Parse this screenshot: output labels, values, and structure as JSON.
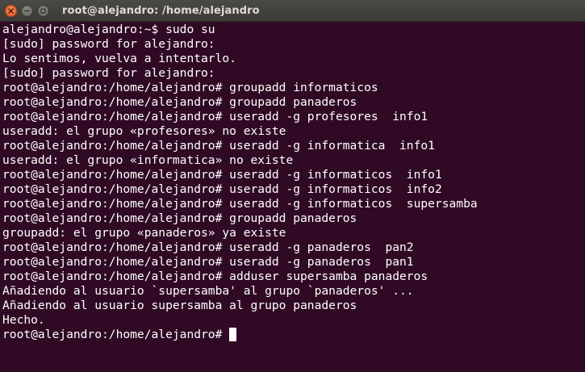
{
  "window": {
    "title": "root@alejandro: /home/alejandro"
  },
  "terminal": {
    "lines": [
      "alejandro@alejandro:~$ sudo su",
      "[sudo] password for alejandro:",
      "Lo sentimos, vuelva a intentarlo.",
      "[sudo] password for alejandro:",
      "root@alejandro:/home/alejandro# groupadd informaticos",
      "root@alejandro:/home/alejandro# groupadd panaderos",
      "root@alejandro:/home/alejandro# useradd -g profesores  info1",
      "useradd: el grupo «profesores» no existe",
      "root@alejandro:/home/alejandro# useradd -g informatica  info1",
      "useradd: el grupo «informatica» no existe",
      "root@alejandro:/home/alejandro# useradd -g informaticos  info1",
      "root@alejandro:/home/alejandro# useradd -g informaticos  info2",
      "root@alejandro:/home/alejandro# useradd -g informaticos  supersamba",
      "root@alejandro:/home/alejandro# groupadd panaderos",
      "groupadd: el grupo «panaderos» ya existe",
      "root@alejandro:/home/alejandro# useradd -g panaderos  pan2",
      "root@alejandro:/home/alejandro# useradd -g panaderos  pan1",
      "root@alejandro:/home/alejandro# adduser supersamba panaderos",
      "Añadiendo al usuario `supersamba' al grupo `panaderos' ...",
      "Añadiendo al usuario supersamba al grupo panaderos",
      "Hecho."
    ],
    "prompt": "root@alejandro:/home/alejandro# "
  },
  "colors": {
    "background": "#300a24",
    "text": "#ffffff",
    "titlebar": "#3c3b37",
    "close_button": "#e05417"
  },
  "icons": {
    "close": "close-icon",
    "minimize": "minimize-icon",
    "maximize": "maximize-icon"
  }
}
